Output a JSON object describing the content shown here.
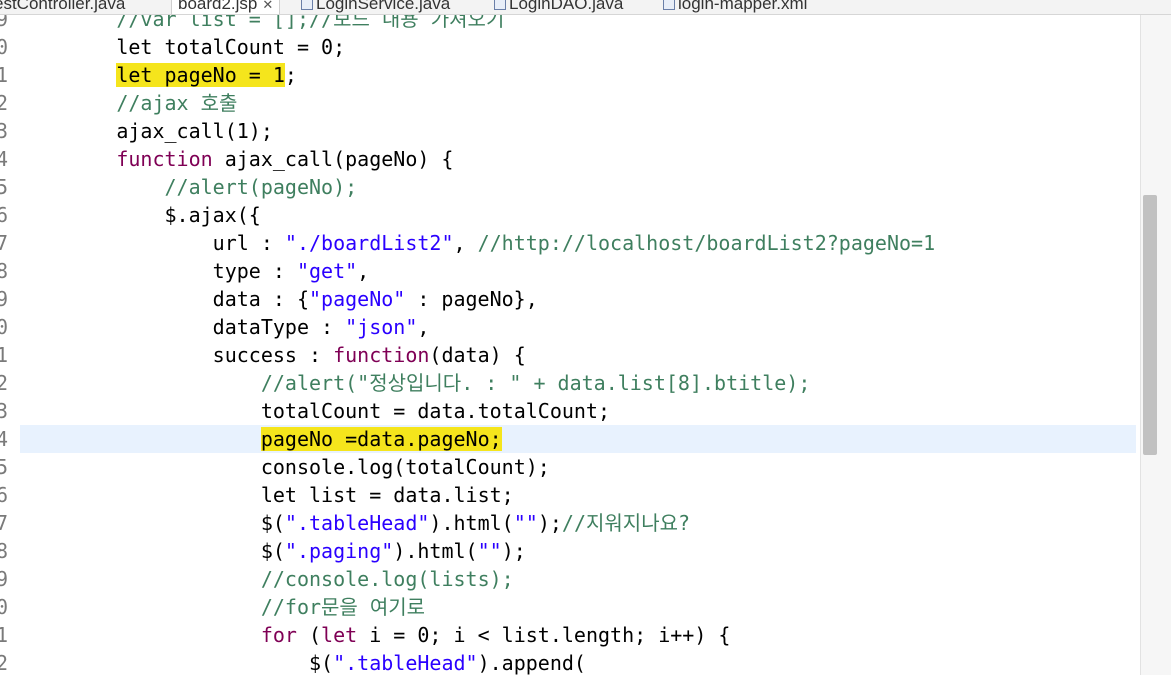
{
  "tabs": [
    {
      "label": "estController.java"
    },
    {
      "label": "board2.jsp",
      "close": "✕"
    },
    {
      "label": "LoginService.java"
    },
    {
      "label": "LoginDAO.java"
    },
    {
      "label": "login-mapper.xml"
    }
  ],
  "line_numbers": [
    "9",
    "0",
    "1",
    "2",
    "3",
    "4",
    "5",
    "6",
    "7",
    "8",
    "9",
    "0",
    "1",
    "2",
    "3",
    "4",
    "5",
    "6",
    "7",
    "8",
    "9",
    "0",
    "1",
    "2"
  ],
  "code": {
    "l0": {
      "text": "//var list = [];//보드 내용 가져오기"
    },
    "l1": {
      "text": "let totalCount = 0;"
    },
    "l2": {
      "text": "let pageNo = 1",
      "semi": ";"
    },
    "l3": {
      "text": "//ajax 호출"
    },
    "l4": {
      "text": "ajax_call(1);"
    },
    "l5": {
      "kw": "function",
      "rest": " ajax_call(pageNo) {"
    },
    "l6": {
      "text": "//alert(pageNo);"
    },
    "l7": {
      "text": "$.ajax({"
    },
    "l8": {
      "a": "url : ",
      "s": "\"./boardList2\"",
      "b": ", ",
      "c": "//http://localhost/boardList2?pageNo=1"
    },
    "l9": {
      "a": "type : ",
      "s": "\"get\"",
      "b": ","
    },
    "l10": {
      "a": "data : {",
      "s": "\"pageNo\"",
      "b": " : pageNo},"
    },
    "l11": {
      "a": "dataType : ",
      "s": "\"json\"",
      "b": ","
    },
    "l12": {
      "a": "success : ",
      "kw": "function",
      "b": "(data) {"
    },
    "l13": {
      "text": "//alert(\"정상입니다. : \" + data.list[8].btitle);"
    },
    "l14": {
      "text": "totalCount = data.totalCount;"
    },
    "l15": {
      "text": "pageNo =data.pageNo;"
    },
    "l16": {
      "text": "console.log(totalCount);"
    },
    "l17": {
      "text": "let list = data.list;"
    },
    "l18": {
      "a": "$(",
      "s": "\".tableHead\"",
      "b": ").html(",
      "s2": "\"\"",
      "c1": ");",
      "c": "//지워지나요?"
    },
    "l19": {
      "a": "$(",
      "s": "\".paging\"",
      "b": ").html(",
      "s2": "\"\"",
      "c1": ");"
    },
    "l20": {
      "text": "//console.log(lists);"
    },
    "l21": {
      "text": "//for문을 여기로"
    },
    "l22": {
      "kw": "for",
      "rest": " (",
      "kw2": "let",
      "rest2": " i = 0; i < list.length; i++) {"
    },
    "l23": {
      "a": "$(",
      "s": "\".tableHead\"",
      "b": ").append("
    }
  }
}
